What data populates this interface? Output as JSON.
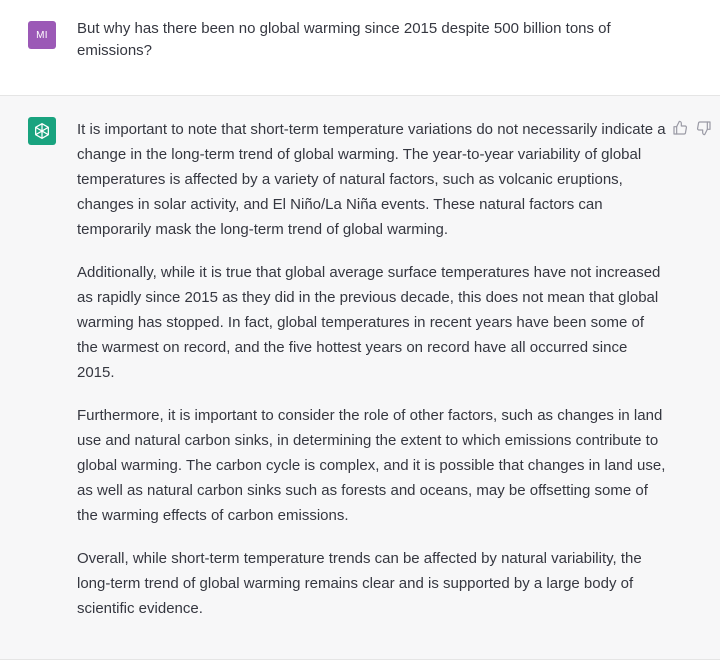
{
  "user_message": {
    "avatar_initials": "MI",
    "text": "But why has there been no global warming since 2015 despite 500 billion tons of emissions?"
  },
  "assistant_message": {
    "avatar_icon": "openai-logo-icon",
    "paragraphs": [
      "It is important to note that short-term temperature variations do not necessarily indicate a change in the long-term trend of global warming. The year-to-year variability of global temperatures is affected by a variety of natural factors, such as volcanic eruptions, changes in solar activity, and El Niño/La Niña events. These natural factors can temporarily mask the long-term trend of global warming.",
      "Additionally, while it is true that global average surface temperatures have not increased as rapidly since 2015 as they did in the previous decade, this does not mean that global warming has stopped. In fact, global temperatures in recent years have been some of the warmest on record, and the five hottest years on record have all occurred since 2015.",
      "Furthermore, it is important to consider the role of other factors, such as changes in land use and natural carbon sinks, in determining the extent to which emissions contribute to global warming. The carbon cycle is complex, and it is possible that changes in land use, as well as natural carbon sinks such as forests and oceans, may be offsetting some of the warming effects of carbon emissions.",
      "Overall, while short-term temperature trends can be affected by natural variability, the long-term trend of global warming remains clear and is supported by a large body of scientific evidence."
    ],
    "feedback_icons": [
      "thumbs-up-icon",
      "thumbs-down-icon"
    ]
  },
  "colors": {
    "user_avatar": "#9b59b6",
    "assistant_avatar": "#19a37f",
    "assistant_background": "#f7f7f8",
    "text": "#353740"
  }
}
